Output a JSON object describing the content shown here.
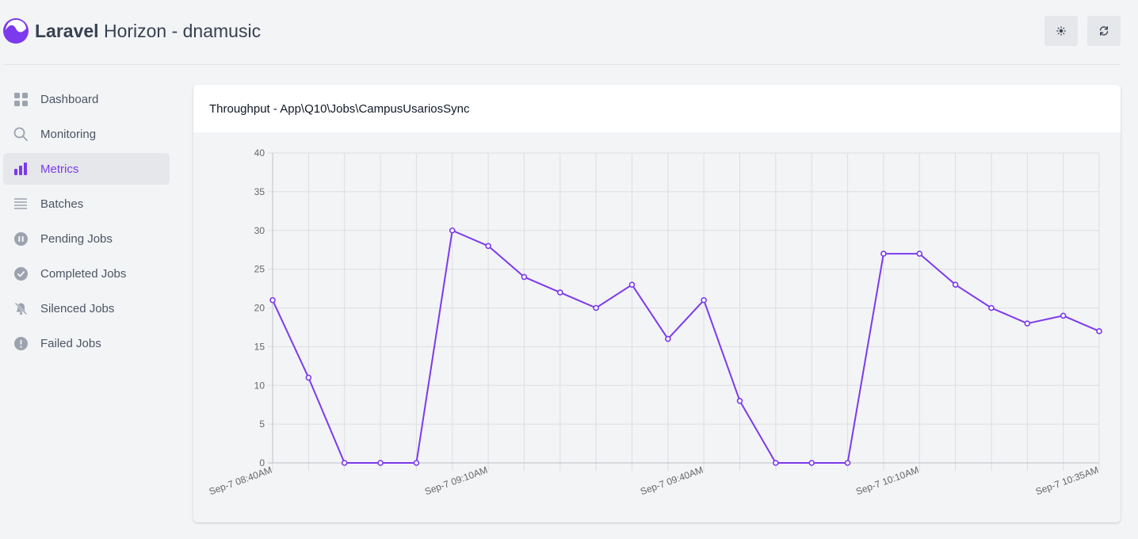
{
  "header": {
    "title_bold": "Laravel",
    "title_rest": " Horizon - dnamusic",
    "buttons": [
      {
        "icon": "sun-icon"
      },
      {
        "icon": "refresh-icon"
      }
    ]
  },
  "sidebar": {
    "items": [
      {
        "label": "Dashboard",
        "icon": "dashboard-icon",
        "active": false
      },
      {
        "label": "Monitoring",
        "icon": "search-icon",
        "active": false
      },
      {
        "label": "Metrics",
        "icon": "bar-chart-icon",
        "active": true
      },
      {
        "label": "Batches",
        "icon": "list-icon",
        "active": false
      },
      {
        "label": "Pending Jobs",
        "icon": "pause-icon",
        "active": false
      },
      {
        "label": "Completed Jobs",
        "icon": "check-circle-icon",
        "active": false
      },
      {
        "label": "Silenced Jobs",
        "icon": "bell-off-icon",
        "active": false
      },
      {
        "label": "Failed Jobs",
        "icon": "alert-circle-icon",
        "active": false
      }
    ]
  },
  "card": {
    "title": "Throughput - App\\Q10\\Jobs\\CampusUsariosSync"
  },
  "colors": {
    "accent": "#7c3aed",
    "grid": "#dcdee2"
  },
  "chart_data": {
    "type": "line",
    "title": "",
    "xlabel": "",
    "ylabel": "",
    "ylim": [
      0,
      40
    ],
    "yticks": [
      0,
      5,
      10,
      15,
      20,
      25,
      30,
      35,
      40
    ],
    "x": [
      "Sep-7 08:40AM",
      "Sep-7 08:45AM",
      "Sep-7 08:50AM",
      "Sep-7 08:55AM",
      "Sep-7 09:00AM",
      "Sep-7 09:05AM",
      "Sep-7 09:10AM",
      "Sep-7 09:15AM",
      "Sep-7 09:20AM",
      "Sep-7 09:25AM",
      "Sep-7 09:30AM",
      "Sep-7 09:35AM",
      "Sep-7 09:40AM",
      "Sep-7 09:45AM",
      "Sep-7 09:50AM",
      "Sep-7 09:55AM",
      "Sep-7 10:00AM",
      "Sep-7 10:05AM",
      "Sep-7 10:10AM",
      "Sep-7 10:15AM",
      "Sep-7 10:20AM",
      "Sep-7 10:25AM",
      "Sep-7 10:30AM",
      "Sep-7 10:35AM"
    ],
    "x_tick_labels": [
      "Sep-7 08:40AM",
      "Sep-7 09:10AM",
      "Sep-7 09:40AM",
      "Sep-7 10:10AM",
      "Sep-7 10:35AM"
    ],
    "series": [
      {
        "values": [
          21,
          11,
          0,
          0,
          0,
          30,
          28,
          24,
          22,
          20,
          23,
          16,
          21,
          8,
          0,
          0,
          0,
          27,
          27,
          23,
          20,
          18,
          19,
          17
        ]
      }
    ],
    "grid": true,
    "legend": "none"
  }
}
